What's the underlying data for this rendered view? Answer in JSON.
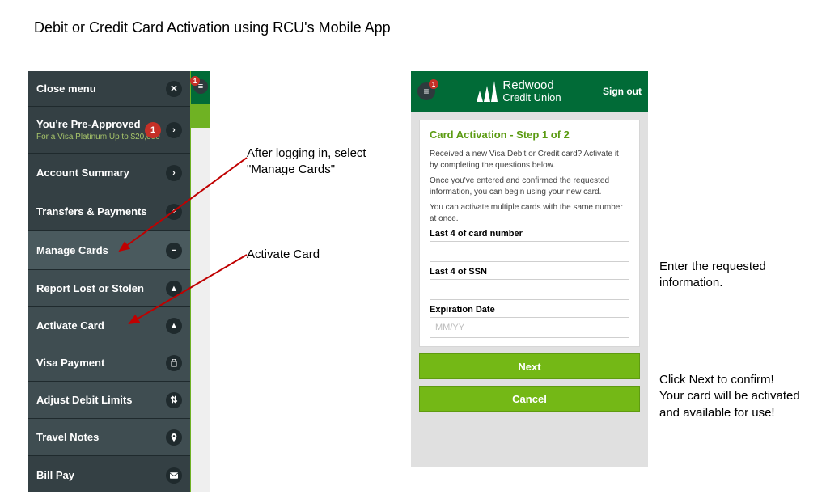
{
  "doc_title": "Debit or Credit Card Activation using RCU's Mobile App",
  "annotations": {
    "a1": "After logging in, select \"Manage Cards\"",
    "a2": "Activate Card",
    "a3": "Enter the requested information.",
    "a4": "Click Next to confirm!\nYour card will be activated and available for use!"
  },
  "menu": {
    "close": "Close menu",
    "preapproved": {
      "title": "You're Pre-Approved",
      "subtitle": "For a Visa Platinum Up to $20,000",
      "badge": "1"
    },
    "items": [
      {
        "label": "Account Summary",
        "icon": "chevron"
      },
      {
        "label": "Transfers & Payments",
        "icon": "plus"
      },
      {
        "label": "Manage Cards",
        "icon": "minus",
        "selected": true
      },
      {
        "label": "Report Lost or Stolen",
        "icon": "alert",
        "sub": true
      },
      {
        "label": "Activate Card",
        "icon": "alert",
        "sub": true
      },
      {
        "label": "Visa Payment",
        "icon": "bag",
        "sub": true
      },
      {
        "label": "Adjust Debit Limits",
        "icon": "sliders",
        "sub": true
      },
      {
        "label": "Travel Notes",
        "icon": "pin",
        "sub": true
      },
      {
        "label": "Bill Pay",
        "icon": "mail"
      }
    ],
    "burger_badge": "1"
  },
  "form": {
    "header": {
      "logo_line1": "Redwood",
      "logo_line2": "Credit Union",
      "sign_out": "Sign out",
      "burger_badge": "1"
    },
    "title": "Card Activation - Step 1 of 2",
    "p1": "Received a new Visa Debit or Credit card? Activate it by completing the questions below.",
    "p2": "Once you've entered and confirmed the requested information, you can begin using your new card.",
    "p3": "You can activate multiple cards with the same number at once.",
    "fields": {
      "card_label": "Last 4 of card number",
      "card_value": "",
      "ssn_label": "Last 4 of SSN",
      "ssn_value": "",
      "exp_label": "Expiration Date",
      "exp_placeholder": "MM/YY",
      "exp_value": ""
    },
    "buttons": {
      "next": "Next",
      "cancel": "Cancel"
    }
  }
}
